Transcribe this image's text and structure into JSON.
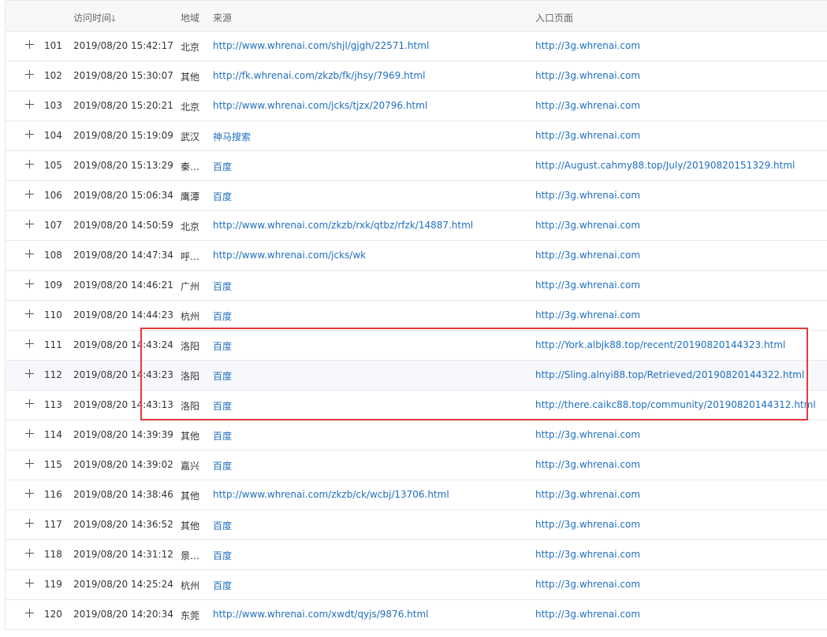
{
  "table": {
    "headers": {
      "time": "访问时间",
      "region": "地域",
      "source": "来源",
      "entry": "入口页面"
    },
    "rows": [
      {
        "num": "101",
        "time": "2019/08/20 15:42:17",
        "region": "北京",
        "source": "http://www.whrenai.com/shjl/gjgh/22571.html",
        "entry": "http://3g.whrenai.com"
      },
      {
        "num": "102",
        "time": "2019/08/20 15:30:07",
        "region": "其他",
        "source": "http://fk.whrenai.com/zkzb/fk/jhsy/7969.html",
        "entry": "http://3g.whrenai.com"
      },
      {
        "num": "103",
        "time": "2019/08/20 15:20:21",
        "region": "北京",
        "source": "http://www.whrenai.com/jcks/tjzx/20796.html",
        "entry": "http://3g.whrenai.com"
      },
      {
        "num": "104",
        "time": "2019/08/20 15:19:09",
        "region": "武汉",
        "source": "神马搜索",
        "entry": "http://3g.whrenai.com"
      },
      {
        "num": "105",
        "time": "2019/08/20 15:13:29",
        "region": "秦…",
        "source": "百度",
        "entry": "http://August.cahmy88.top/July/20190820151329.html"
      },
      {
        "num": "106",
        "time": "2019/08/20 15:06:34",
        "region": "鹰潭",
        "source": "百度",
        "entry": "http://3g.whrenai.com"
      },
      {
        "num": "107",
        "time": "2019/08/20 14:50:59",
        "region": "北京",
        "source": "http://www.whrenai.com/zkzb/rxk/qtbz/rfzk/14887.html",
        "entry": "http://3g.whrenai.com"
      },
      {
        "num": "108",
        "time": "2019/08/20 14:47:34",
        "region": "呼…",
        "source": "http://www.whrenai.com/jcks/wk",
        "entry": "http://3g.whrenai.com"
      },
      {
        "num": "109",
        "time": "2019/08/20 14:46:21",
        "region": "广州",
        "source": "百度",
        "entry": "http://3g.whrenai.com"
      },
      {
        "num": "110",
        "time": "2019/08/20 14:44:23",
        "region": "杭州",
        "source": "百度",
        "entry": "http://3g.whrenai.com"
      },
      {
        "num": "111",
        "time": "2019/08/20 14:43:24",
        "region": "洛阳",
        "source": "百度",
        "entry": "http://York.albjk88.top/recent/20190820144323.html"
      },
      {
        "num": "112",
        "time": "2019/08/20 14:43:23",
        "region": "洛阳",
        "source": "百度",
        "entry": "http://Sling.alnyi88.top/Retrieved/20190820144322.html"
      },
      {
        "num": "113",
        "time": "2019/08/20 14:43:13",
        "region": "洛阳",
        "source": "百度",
        "entry": "http://there.caikc88.top/community/20190820144312.html"
      },
      {
        "num": "114",
        "time": "2019/08/20 14:39:39",
        "region": "其他",
        "source": "百度",
        "entry": "http://3g.whrenai.com"
      },
      {
        "num": "115",
        "time": "2019/08/20 14:39:02",
        "region": "嘉兴",
        "source": "百度",
        "entry": "http://3g.whrenai.com"
      },
      {
        "num": "116",
        "time": "2019/08/20 14:38:46",
        "region": "其他",
        "source": "http://www.whrenai.com/zkzb/ck/wcbj/13706.html",
        "entry": "http://3g.whrenai.com"
      },
      {
        "num": "117",
        "time": "2019/08/20 14:36:52",
        "region": "其他",
        "source": "百度",
        "entry": "http://3g.whrenai.com"
      },
      {
        "num": "118",
        "time": "2019/08/20 14:31:12",
        "region": "景…",
        "source": "百度",
        "entry": "http://3g.whrenai.com"
      },
      {
        "num": "119",
        "time": "2019/08/20 14:25:24",
        "region": "杭州",
        "source": "百度",
        "entry": "http://3g.whrenai.com"
      },
      {
        "num": "120",
        "time": "2019/08/20 14:20:34",
        "region": "东莞",
        "source": "http://www.whrenai.com/xwdt/qyjs/9876.html",
        "entry": "http://3g.whrenai.com"
      }
    ]
  },
  "colors": {
    "link": "#1f6fbf",
    "highlight_box": "#e4393c",
    "header_bg": "#f7f8fa"
  }
}
